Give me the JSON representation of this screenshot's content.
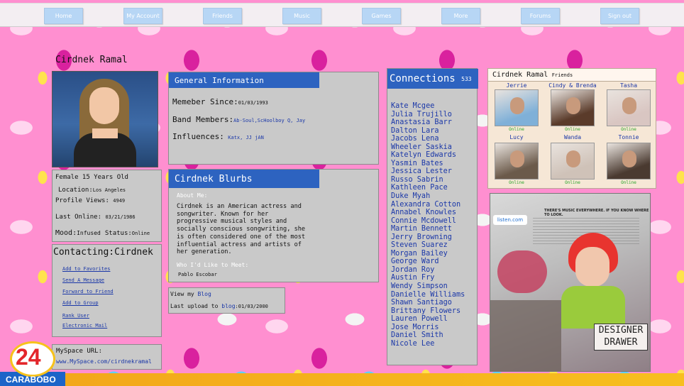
{
  "nav": [
    "Home",
    "My Account",
    "Friends",
    "Music",
    "Games",
    "More",
    "Forums",
    "Sign out"
  ],
  "profile": {
    "name": "Cirdnek Ramal",
    "gender_age": "Female 15 Years Old",
    "location_label": "Location:",
    "location": "Los Angeles",
    "views_label": "Profile Views:",
    "views": "4949",
    "last_online_label": "Last Online:",
    "last_online": "03/21/1986",
    "mood_label": "Mood:",
    "mood": "Infused",
    "status_label": "Status:",
    "status": "Online"
  },
  "contacting": {
    "title": "Contacting:Cirdnek",
    "links": [
      "Add to Favorites",
      "Send A Message",
      "Forward to Friend",
      "Add to Group",
      "Rank User",
      "Electronic Mail"
    ]
  },
  "url_box": {
    "label": "MySpace URL:",
    "url": "www.MySpace.com/cirdnekramal"
  },
  "general": {
    "title": "General Information",
    "member_since_label": "Memeber Since:",
    "member_since": "01/03/1993",
    "band_label": "Band Members:",
    "band": "Ab-Soul,ScHoolboy Q, Jay",
    "influences_label": "Influences:",
    "influences": "Katx, JJ jAN"
  },
  "blurbs": {
    "title": "Cirdnek Blurbs",
    "about_label": "About Me:",
    "about_lines": [
      "Cirdnek is an American actress and",
      "songwriter. Known for her",
      "progressive musical styles and",
      "socially conscious songwriting, she",
      "is often considered one of the most",
      "influential actress and artists of",
      "her generation."
    ],
    "meet_label": "Who I'd Like to Meet:",
    "meet": "Pablo Escobar"
  },
  "blog": {
    "view_prefix": "View my ",
    "blog_word": "Blog",
    "upload_prefix": "Last upload to ",
    "upload_link": "blog",
    "upload_date": ":01/03/2000"
  },
  "connections": {
    "title": "Connections",
    "count": "533",
    "names": [
      "Kate Mcgee",
      "Julia Trujillo",
      "Anastasia Barr",
      "Dalton Lara",
      "Jacobs Lena",
      "Wheeler Saskia",
      "Katelyn Edwards",
      "Yasmin Bates",
      "Jessica Lester",
      "Russo Sabrin",
      "Kathleen Pace",
      "Duke Myah",
      "Alexandra Cotton",
      "Annabel Knowles",
      "Connie Mcdowell",
      "Martin Bennett",
      "Jerry Browning",
      "Steven Suarez",
      "Morgan Bailey",
      "George Ward",
      "Jordan Roy",
      "Austin Fry",
      "Wendy Simpson",
      "Danielle Williams",
      "Shawn Santiago",
      "Brittany Flowers",
      "Lauren Powell",
      "Jose Morris",
      "Daniel Smith",
      "Nicole Lee"
    ]
  },
  "friends": {
    "title": "Cirdnek Ramal",
    "suffix": "Friends",
    "online_text": "Online",
    "items": [
      {
        "name": "Jerrie",
        "color": "#7fb0d8"
      },
      {
        "name": "Cindy & Brenda",
        "color": "#5a3b2a"
      },
      {
        "name": "Tasha",
        "color": "#d9c6c2"
      },
      {
        "name": "Lucy",
        "color": "#6b5a4a"
      },
      {
        "name": "Wanda",
        "color": "#cfc2b8"
      },
      {
        "name": "Tonnie",
        "color": "#4a3a30"
      }
    ]
  },
  "ad": {
    "headline": "THERE'S MUSIC EVERYWHERE. IF YOU KNOW WHERE TO LOOK.",
    "brand": "listen.com",
    "sign_line1": "DESIGNER",
    "sign_line2": "DRAWER"
  },
  "watermark": {
    "number": "24",
    "place": "CARABOBO"
  }
}
